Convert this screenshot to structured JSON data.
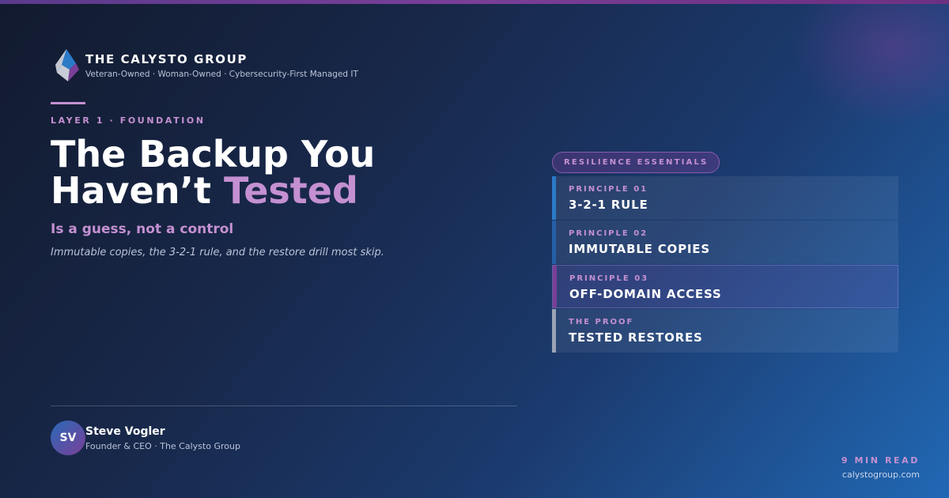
{
  "brand": {
    "name": "THE CALYSTO GROUP",
    "tagline": "Veteran-Owned · Woman-Owned · Cybersecurity-First Managed IT",
    "logo_icon": "calysto-logo-icon"
  },
  "article": {
    "eyebrow": "LAYER 1 · FOUNDATION",
    "headline_part1": "The Backup You Haven’t ",
    "headline_accent": "Tested",
    "subheadline": "Is a guess, not a control",
    "dek": "Immutable copies, the 3-2-1 rule, and the restore drill most skip."
  },
  "sidebar": {
    "pill": "RESILIENCE ESSENTIALS",
    "items": [
      {
        "label": "PRINCIPLE 01",
        "title": "3-2-1 RULE",
        "bar_color": "#2a7ac8"
      },
      {
        "label": "PRINCIPLE 02",
        "title": "IMMUTABLE COPIES",
        "bar_color": "#245fa8"
      },
      {
        "label": "PRINCIPLE 03",
        "title": "OFF-DOMAIN ACCESS",
        "bar_color": "#7a3f98"
      },
      {
        "label": "THE PROOF",
        "title": "TESTED RESTORES",
        "bar_color": "#9aa3b5"
      }
    ]
  },
  "author": {
    "initials": "SV",
    "name": "Steve Vogler",
    "role": "Founder & CEO · The Calysto Group"
  },
  "footer": {
    "read_time": "9 MIN READ",
    "url": "calystogroup.com"
  },
  "colors": {
    "accent": "#c490d1",
    "top_bar": "#7a3f98",
    "background_start": "#121a2e",
    "background_end": "#2168b4"
  }
}
